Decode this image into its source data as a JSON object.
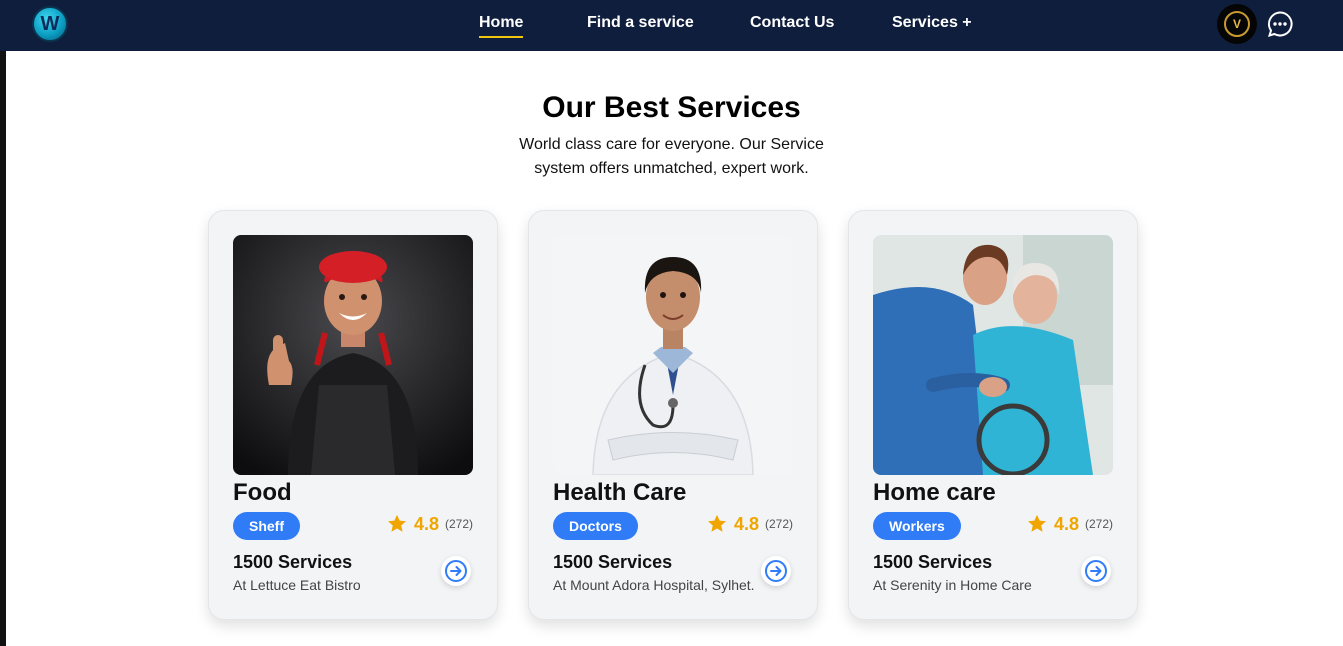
{
  "nav": {
    "logo_letter": "W",
    "links": [
      "Home",
      "Find a service",
      "Contact Us",
      "Services +"
    ],
    "avatar_letter": "V"
  },
  "section": {
    "title": "Our Best Services",
    "subtitle_line1": "World class care for everyone. Our Service",
    "subtitle_line2": "system offers unmatched, expert work."
  },
  "cards": [
    {
      "title": "Food",
      "badge": "Sheff",
      "rating": "4.8",
      "reviews": "(272)",
      "services": "1500 Services",
      "location": "At Lettuce Eat Bistro"
    },
    {
      "title": "Health Care",
      "badge": "Doctors",
      "rating": "4.8",
      "reviews": "(272)",
      "services": "1500 Services",
      "location": "At Mount Adora Hospital, Sylhet."
    },
    {
      "title": "Home care",
      "badge": "Workers",
      "rating": "4.8",
      "reviews": "(272)",
      "services": "1500 Services",
      "location": "At Serenity in Home Care"
    }
  ],
  "colors": {
    "navbar": "#0f1e3d",
    "accent": "#2f7cf6",
    "star": "#f0a500",
    "active_underline": "#f1c40f"
  }
}
